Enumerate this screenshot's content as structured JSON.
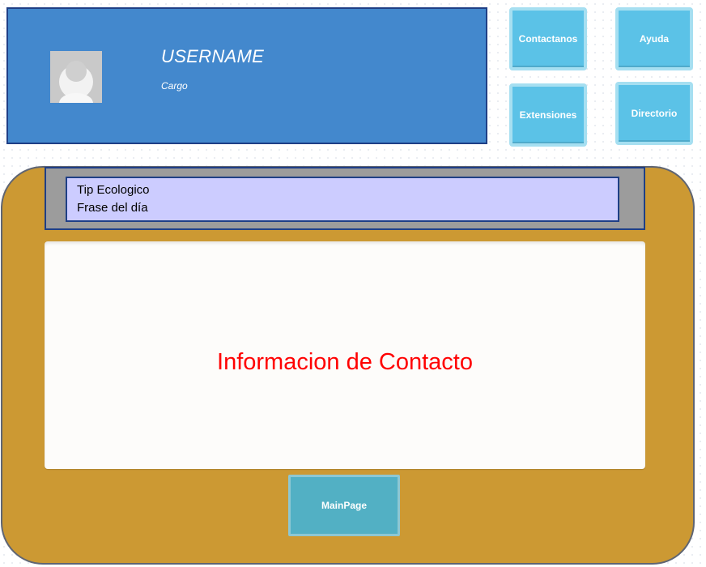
{
  "profile": {
    "username": "USERNAME",
    "role": "Cargo"
  },
  "nav": {
    "contact_label": "Contactanos",
    "help_label": "Ayuda",
    "extensions_label": "Extensiones",
    "directory_label": "Directorio"
  },
  "tip": {
    "title": "Tip Ecologico",
    "phrase": "Frase del día"
  },
  "main": {
    "section_title": "Informacion de Contacto"
  },
  "footer": {
    "mainpage_label": "MainPage"
  },
  "colors": {
    "header_blue": "#4388cd",
    "tile_cyan": "#5bc2e7",
    "panel_gold": "#cc9933",
    "tip_lavender": "#ccccff",
    "title_red": "#ff0000",
    "mainpage_teal": "#52b0c4"
  },
  "icons": {
    "avatar": "user-avatar-icon"
  }
}
